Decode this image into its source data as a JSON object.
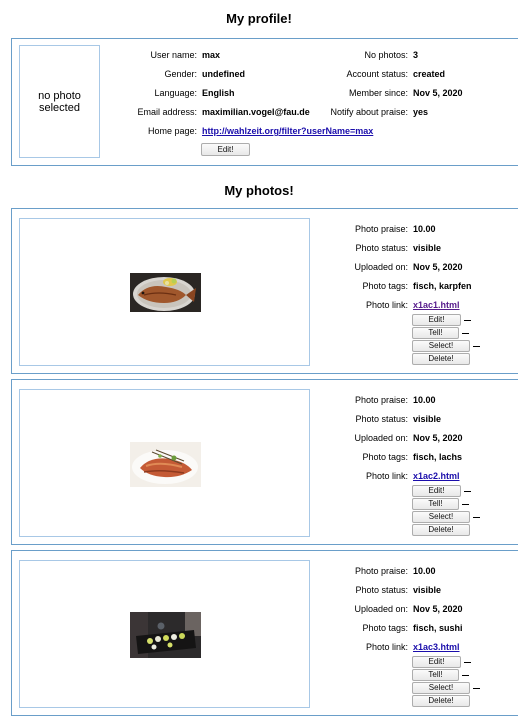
{
  "profile": {
    "heading": "My profile!",
    "no_photo_text": "no photo selected",
    "fields": {
      "user_name": {
        "label": "User name:",
        "value": "max"
      },
      "gender": {
        "label": "Gender:",
        "value": "undefined"
      },
      "language": {
        "label": "Language:",
        "value": "English"
      },
      "email": {
        "label": "Email address:",
        "value": "maximilian.vogel@fau.de"
      },
      "home_page": {
        "label": "Home page:",
        "value": "http://wahlzeit.org/filter?userName=max"
      },
      "no_photos": {
        "label": "No photos:",
        "value": "3"
      },
      "account_status": {
        "label": "Account status:",
        "value": "created"
      },
      "member_since": {
        "label": "Member since:",
        "value": "Nov 5, 2020"
      },
      "notify_praise": {
        "label": "Notify about praise:",
        "value": "yes"
      }
    },
    "edit_label": "Edit!"
  },
  "photos_heading": "My photos!",
  "photo_labels": {
    "praise": "Photo praise:",
    "status": "Photo status:",
    "uploaded": "Uploaded on:",
    "tags": "Photo tags:",
    "link": "Photo link:"
  },
  "photo_buttons": {
    "edit": "Edit!",
    "tell": "Tell!",
    "select": "Select!",
    "delete": "Delete!"
  },
  "photos": [
    {
      "praise": "10.00",
      "status": "visible",
      "uploaded": "Nov 5, 2020",
      "tags": "fisch, karpfen",
      "link": "x1ac1.html"
    },
    {
      "praise": "10.00",
      "status": "visible",
      "uploaded": "Nov 5, 2020",
      "tags": "fisch, lachs",
      "link": "x1ac2.html"
    },
    {
      "praise": "10.00",
      "status": "visible",
      "uploaded": "Nov 5, 2020",
      "tags": "fisch, sushi",
      "link": "x1ac3.html"
    }
  ],
  "colors": {
    "border": "#6a9ec9",
    "link": "#1a0dab",
    "visited_link": "#551a8b"
  }
}
